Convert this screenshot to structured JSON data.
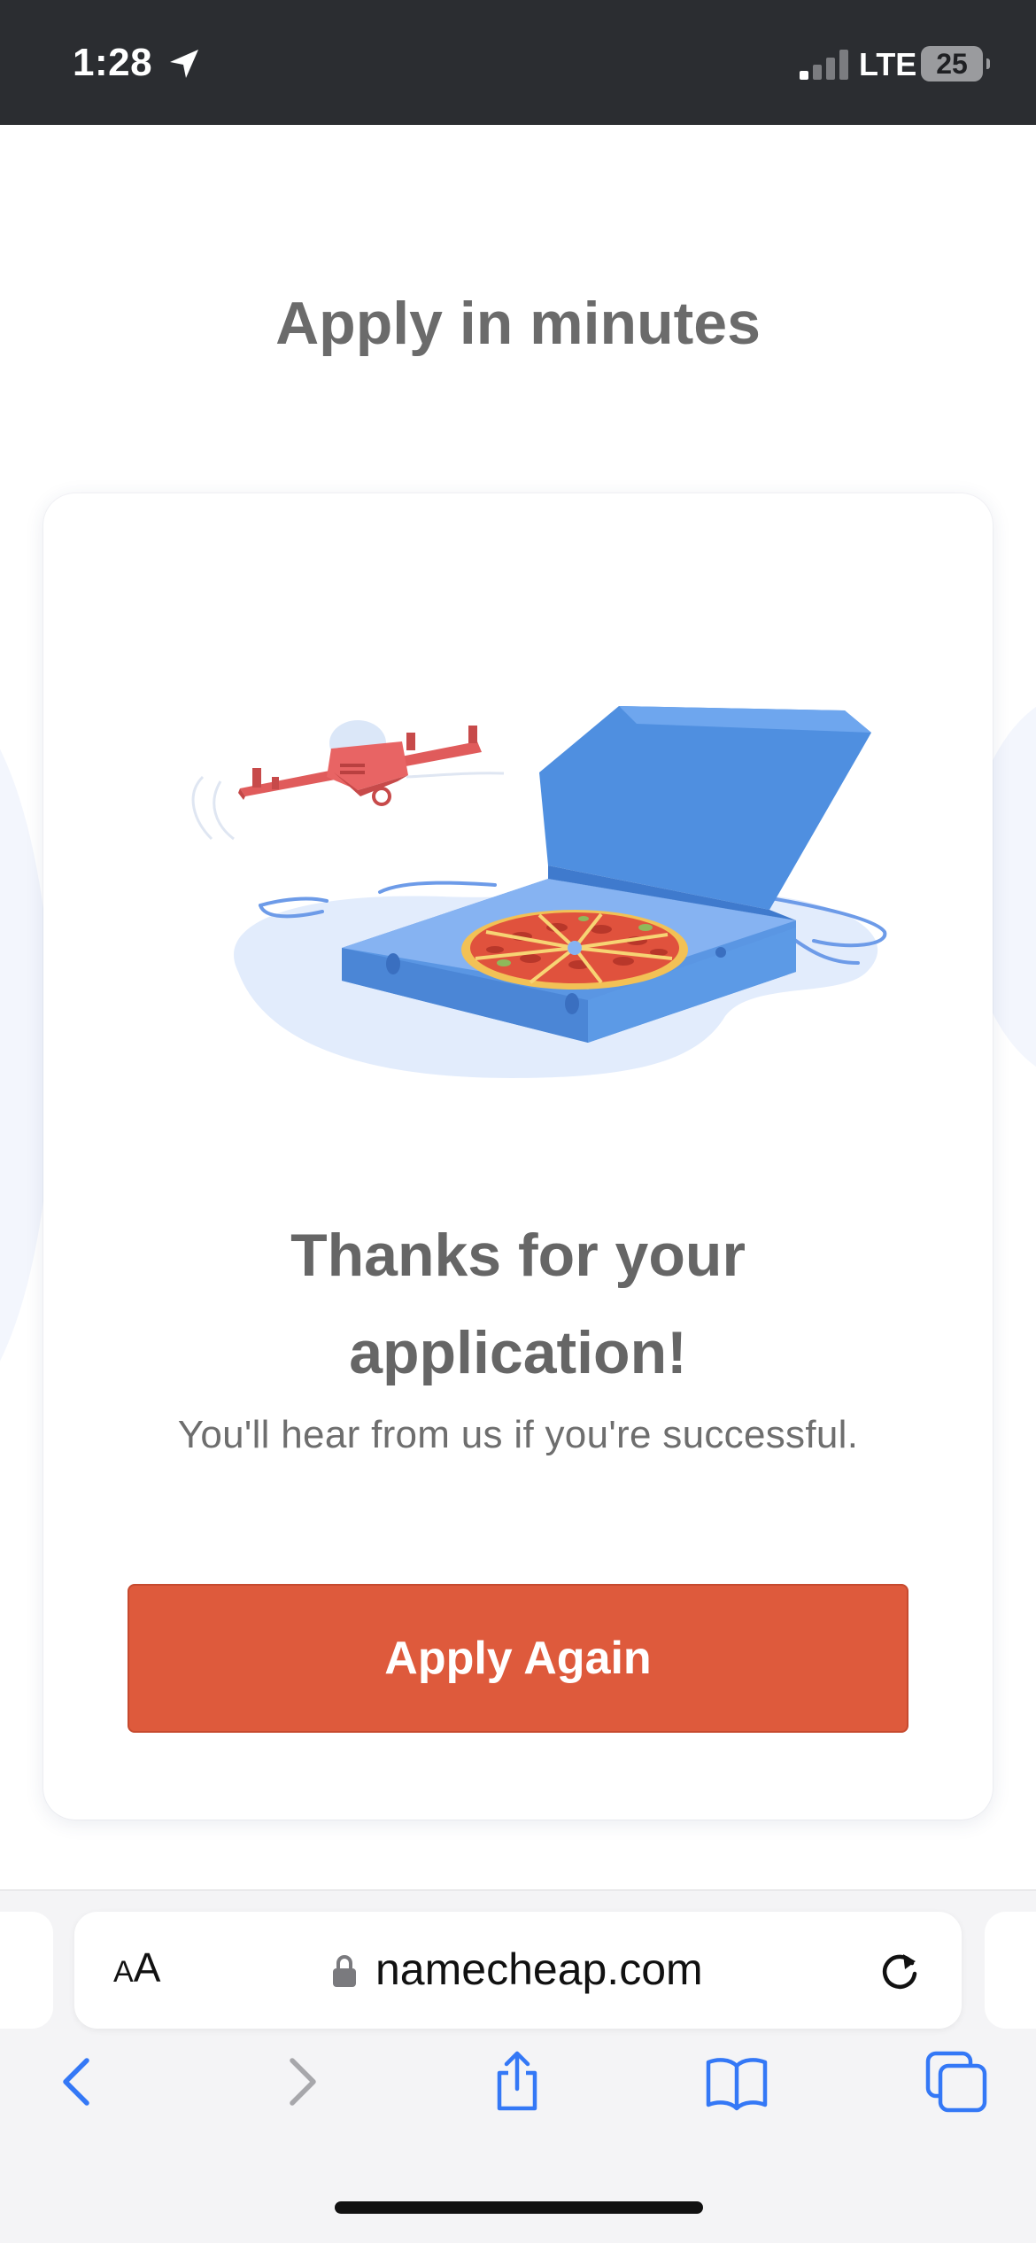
{
  "status_bar": {
    "time": "1:28",
    "network": "LTE",
    "battery": "25"
  },
  "page": {
    "title": "Apply in minutes",
    "card": {
      "heading_line1": "Thanks for your",
      "heading_line2": "application!",
      "subtitle": "You'll hear from us if you're successful.",
      "button_label": "Apply Again"
    }
  },
  "browser": {
    "text_size_label_small": "A",
    "text_size_label_large": "A",
    "url": "namecheap.com"
  },
  "colors": {
    "accent_button": "#de5a3c",
    "title_gray": "#6b6b6b",
    "ios_blue": "#3478f6",
    "status_bar_bg": "#2b2d31"
  },
  "icons": {
    "location": "location-arrow-icon",
    "lock": "lock-icon",
    "reload": "reload-icon",
    "back": "chevron-left-icon",
    "forward": "chevron-right-icon",
    "share": "share-icon",
    "bookmarks": "book-icon",
    "tabs": "tabs-icon"
  }
}
